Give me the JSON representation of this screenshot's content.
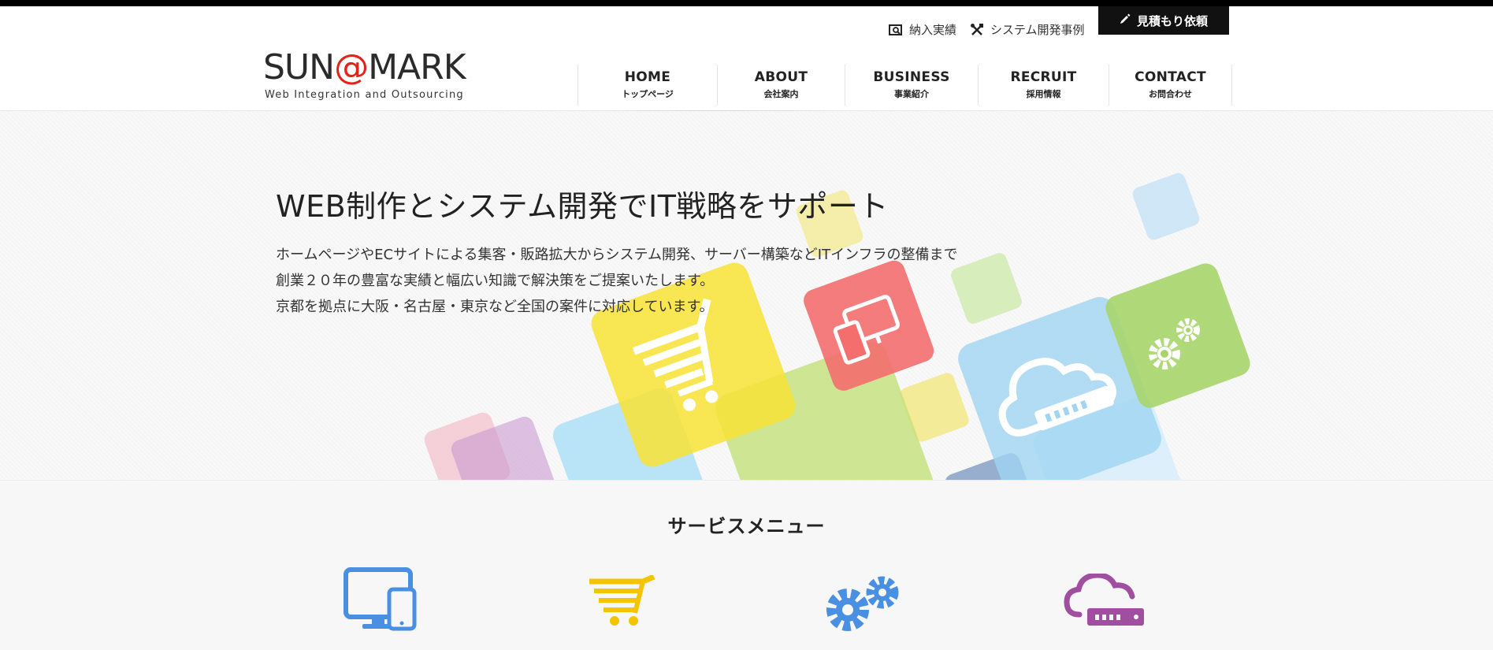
{
  "logo": {
    "main_before": "SUN",
    "main_at": "@",
    "main_after": "MARK",
    "subtitle": "Web Integration and Outsourcing"
  },
  "utility": {
    "works_label": "納入実績",
    "system_cases_label": "システム開発事例",
    "estimate_label": "見積もり依頼"
  },
  "nav": {
    "items": [
      {
        "en": "HOME",
        "ja": "トップページ"
      },
      {
        "en": "ABOUT",
        "ja": "会社案内"
      },
      {
        "en": "BUSINESS",
        "ja": "事業紹介"
      },
      {
        "en": "RECRUIT",
        "ja": "採用情報"
      },
      {
        "en": "CONTACT",
        "ja": "お問合わせ"
      }
    ]
  },
  "hero": {
    "title": "WEB制作とシステム開発でIT戦略をサポート",
    "lines": [
      "ホームページやECサイトによる集客・販路拡大からシステム開発、サーバー構築などITインフラの整備まで",
      "創業２０年の豊富な実績と幅広い知識で解決策をご提案いたします。",
      "京都を拠点に大阪・名古屋・東京など全国の案件に対応しています。"
    ]
  },
  "services": {
    "title": "サービスメニュー",
    "icons": [
      "devices-icon",
      "cart-icon",
      "gears-icon",
      "cloud-server-icon"
    ]
  },
  "colors": {
    "accent_red": "#e2231a",
    "tile_yellow": "#f7e23a",
    "tile_red": "#f46e6e",
    "tile_green": "#a7d56b",
    "tile_blue": "#9fd4f2",
    "icon_blue": "#4a90e2",
    "icon_yellow": "#f5c400",
    "icon_purple": "#a04ea0"
  }
}
